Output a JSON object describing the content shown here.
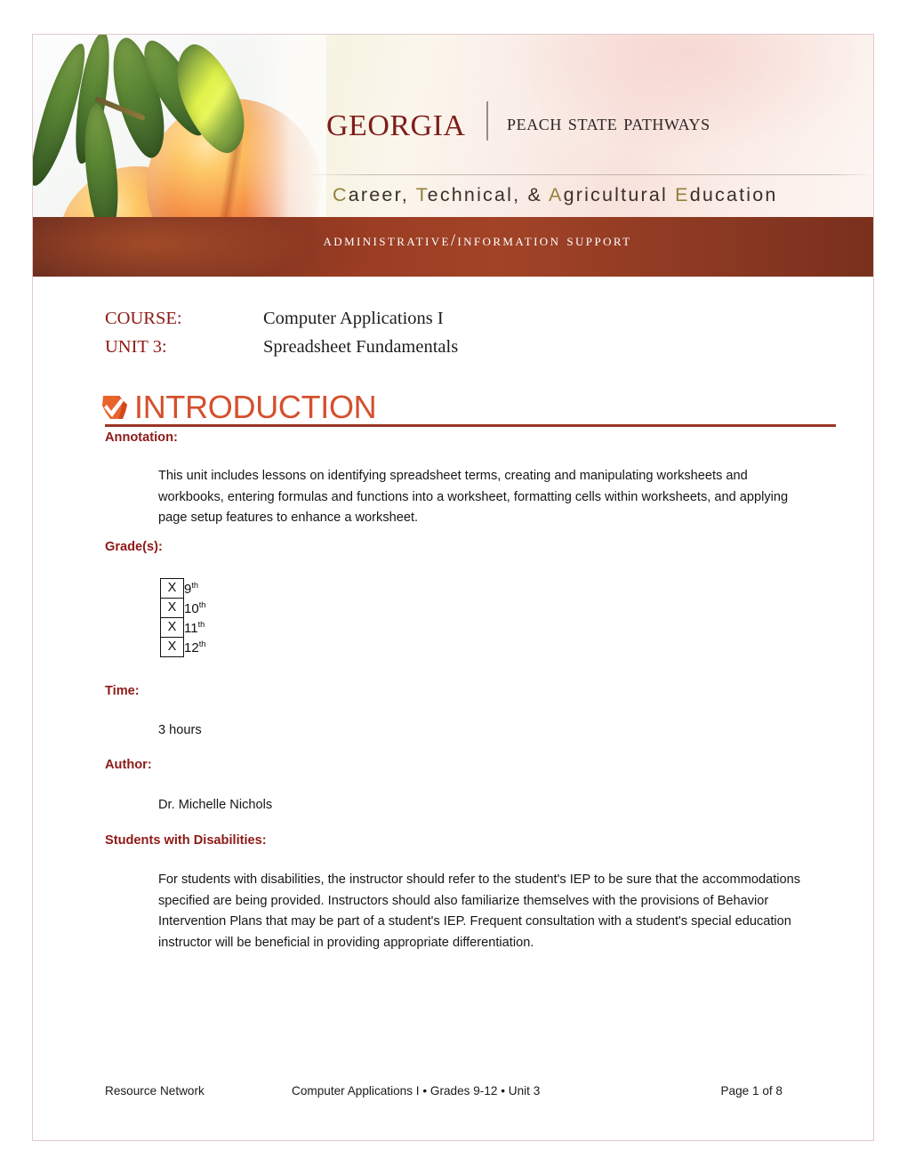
{
  "banner": {
    "wordmark": "Georgia",
    "tagline": "Peach State Pathways",
    "subtitle": "Career, Technical, & Agricultural Education",
    "pathway_band": "Administrative/information Support",
    "accent_brown": "#8e3a23",
    "accent_maroon": "#7e1d1a",
    "accent_olive": "#93803a"
  },
  "course": {
    "course_label": "COURSE:",
    "course_value": "Computer Applications I",
    "unit_label": "UNIT 3:",
    "unit_value": "Spreadsheet Fundamentals"
  },
  "section": {
    "icon": "georgia-check-icon",
    "title": "INTRODUCTION",
    "title_color": "#d4502c",
    "rule_color": "#9c3425"
  },
  "annotation": {
    "heading": "Annotation:",
    "text": "This unit includes lessons on identifying spreadsheet terms, creating and manipulating worksheets and workbooks, entering formulas and functions into a worksheet, formatting cells within worksheets, and applying page setup features to enhance a worksheet."
  },
  "grades": {
    "heading": "Grade(s):",
    "rows": [
      {
        "mark": "X",
        "grade": "9",
        "suffix": "th"
      },
      {
        "mark": "X",
        "grade": "10",
        "suffix": "th"
      },
      {
        "mark": "X",
        "grade": "11",
        "suffix": "th"
      },
      {
        "mark": "X",
        "grade": "12",
        "suffix": "th"
      }
    ]
  },
  "time": {
    "heading": "Time:",
    "text": "3 hours"
  },
  "author": {
    "heading": "Author:",
    "text": "Dr. Michelle Nichols"
  },
  "students_with_disabilities": {
    "heading": "Students with Disabilities:",
    "text": "For students with disabilities, the instructor should refer to the student's IEP to be sure that the accommodations specified are being provided. Instructors should also familiarize themselves with the provisions of Behavior Intervention Plans that may be part of a student's IEP. Frequent consultation with a student's special education instructor will be beneficial in providing appropriate differentiation."
  },
  "footer": {
    "left": "Resource Network",
    "center": "Computer Applications I • Grades 9-12 • Unit 3",
    "right": "Page 1 of 8"
  },
  "heading_color": "#8e1a17"
}
